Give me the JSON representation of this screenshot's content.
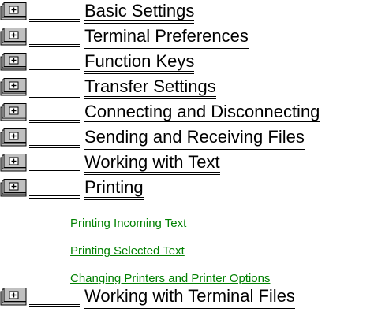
{
  "topics": [
    {
      "label": "Basic Settings",
      "icon": "book-icon"
    },
    {
      "label": "Terminal Preferences",
      "icon": "book-icon"
    },
    {
      "label": "Function Keys",
      "icon": "book-icon"
    },
    {
      "label": "Transfer Settings",
      "icon": "book-icon"
    },
    {
      "label": "Connecting and Disconnecting",
      "icon": "book-icon"
    },
    {
      "label": "Sending and Receiving Files",
      "icon": "book-icon"
    },
    {
      "label": "Working with Text",
      "icon": "book-icon"
    },
    {
      "label": "Printing",
      "icon": "book-icon"
    },
    {
      "label": "Working with Terminal Files",
      "icon": "book-icon"
    }
  ],
  "printing_subtopics": [
    "Printing Incoming Text",
    "Printing Selected Text",
    "Changing Printers and Printer Options"
  ],
  "colors": {
    "topic_text": "#000000",
    "subtopic_link": "#008000",
    "book_fill": "#c0c0c0"
  }
}
